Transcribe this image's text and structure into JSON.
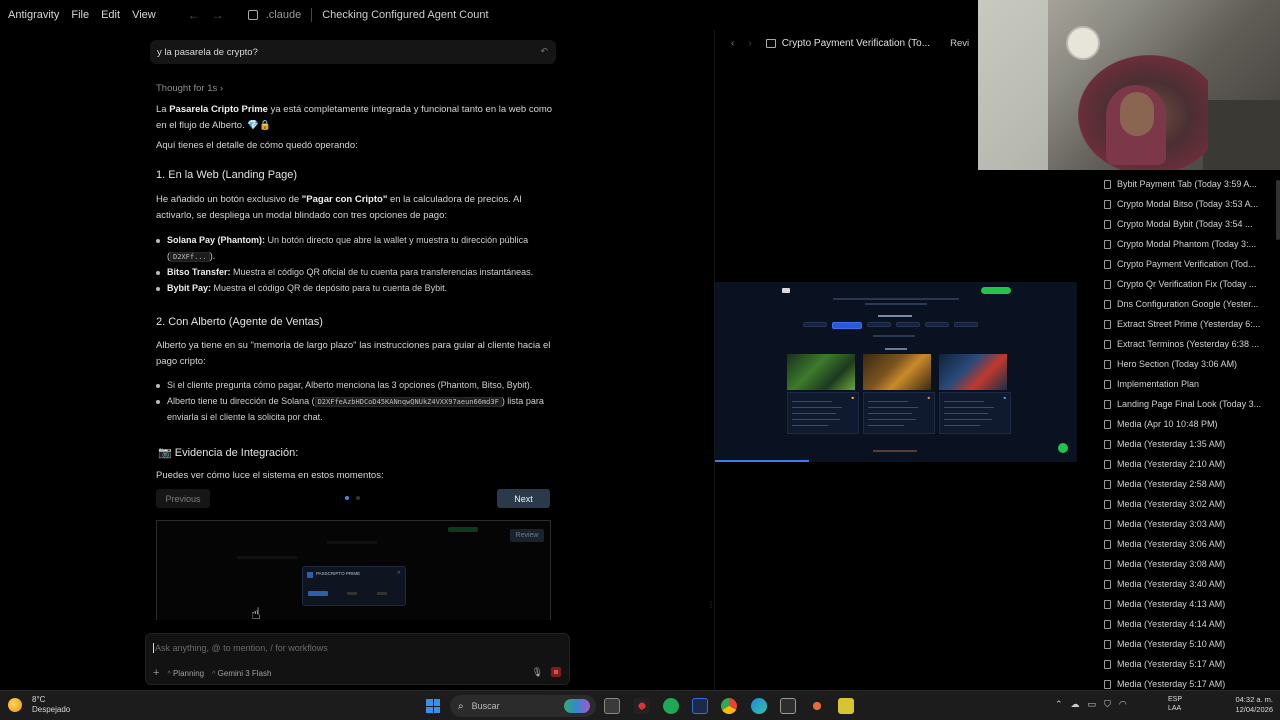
{
  "titlebar": {
    "menu": [
      "Antigravity",
      "File",
      "Edit",
      "View"
    ],
    "folder": ".claude",
    "conversation_title": "Checking Configured Agent Count"
  },
  "chat": {
    "user_message": "y la pasarela de crypto?",
    "thought": "Thought for 1s",
    "intro_pre": "La ",
    "intro_bold": "Pasarela Cripto Prime",
    "intro_post": " ya está completamente integrada y funcional tanto en la web como en el flujo de Alberto. 💎🔒",
    "detail_line": "Aquí tienes el detalle de cómo quedó operando:",
    "section1_title": "1. En la Web (Landing Page)",
    "section1_pre": "He añadido un botón exclusivo de ",
    "section1_bold": "\"Pagar con Cripto\"",
    "section1_post": " en la calculadora de precios. Al activarlo, se despliega un modal blindado con tres opciones de pago:",
    "section1_items": [
      {
        "label": "Solana Pay (Phantom):",
        "text": " Un botón directo que abre la wallet y muestra tu dirección pública (",
        "code": "D2XFf...",
        "tail": ")."
      },
      {
        "label": "Bitso Transfer:",
        "text": " Muestra el código QR oficial de tu cuenta para transferencias instantáneas."
      },
      {
        "label": "Bybit Pay:",
        "text": " Muestra el código QR de depósito para tu cuenta de Bybit."
      }
    ],
    "section2_title": "2. Con Alberto (Agente de Ventas)",
    "section2_text": "Alberto ya tiene en su \"memoria de largo plazo\" las instrucciones para guiar al cliente hacia el pago cripto:",
    "section2_items": [
      {
        "text": "Si el cliente pregunta cómo pagar, Alberto menciona las 3 opciones (Phantom, Bitso, Bybit)."
      },
      {
        "text": "Alberto tiene tu dirección de Solana (",
        "code": "D2XFfeAzbHDCoD45KANnqwQNUkZ4VXX97aeun66md3F",
        "tail": ") lista para enviarla si el cliente la solicita por chat."
      }
    ],
    "evidence_title": "📷 Evidencia de Integración:",
    "evidence_text": "Puedes ver cómo luce el sistema en estos momentos:",
    "prev_label": "Previous",
    "next_label": "Next",
    "carousel_index": 1,
    "carousel_total": 2,
    "evidence_review": "Review",
    "evidence_modal_title": "PASSCRIPTO PRIME",
    "input_placeholder": "Ask anything, @ to mention, / for workflows",
    "mode_label": "Planning",
    "model_label": "Gemini 3 Flash"
  },
  "browser": {
    "title": "Crypto Payment Verification (To...",
    "review_label": "Revi",
    "progress": 0.26
  },
  "right_list": [
    "Bybit Payment Tab (Today 3:59 A...",
    "Crypto Modal Bitso (Today 3:53 A...",
    "Crypto Modal Bybit (Today 3:54 ...",
    "Crypto Modal Phantom (Today 3:...",
    "Crypto Payment Verification (Tod...",
    "Crypto Qr Verification Fix (Today ...",
    "Dns Configuration Google (Yester...",
    "Extract Street Prime (Yesterday 6:...",
    "Extract Terminos (Yesterday 6:38 ...",
    "Hero Section (Today 3:06 AM)",
    "Implementation Plan",
    "Landing Page Final Look (Today 3...",
    "Media (Apr 10 10:48 PM)",
    "Media (Yesterday 1:35 AM)",
    "Media (Yesterday 2:10 AM)",
    "Media (Yesterday 2:58 AM)",
    "Media (Yesterday 3:02 AM)",
    "Media (Yesterday 3:03 AM)",
    "Media (Yesterday 3:06 AM)",
    "Media (Yesterday 3:08 AM)",
    "Media (Yesterday 3:40 AM)",
    "Media (Yesterday 4:13 AM)",
    "Media (Yesterday 4:14 AM)",
    "Media (Yesterday 5:10 AM)",
    "Media (Yesterday 5:17 AM)",
    "Media (Yesterday 5:17 AM)"
  ],
  "taskbar": {
    "temperature": "8°C",
    "weather": "Despejado",
    "search_placeholder": "Buscar",
    "lang1": "ESP",
    "lang2": "LAA",
    "time": "04:32 a. m.",
    "date": "12/04/2026"
  },
  "colors": {
    "accent_blue": "#2b3a4a",
    "dot_active": "#3c8be6",
    "site_bg": "#0a1120",
    "cta_green": "#22c34a"
  }
}
